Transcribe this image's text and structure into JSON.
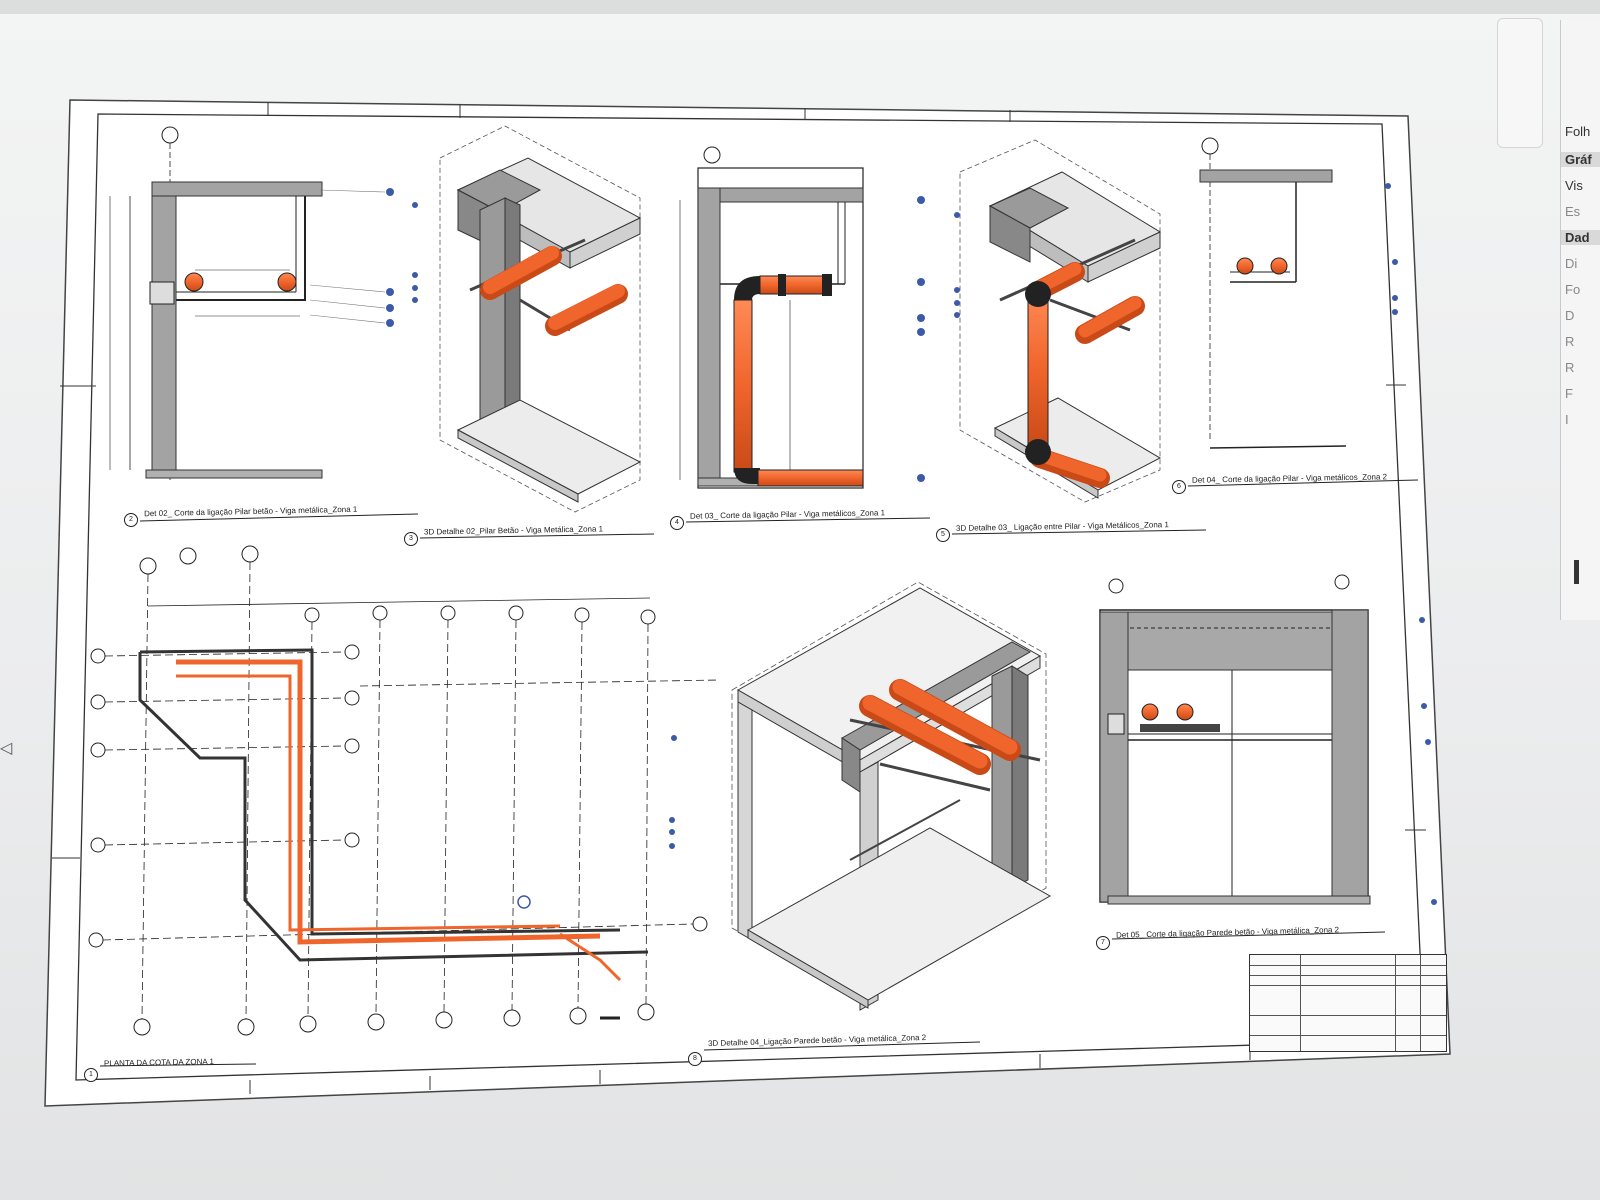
{
  "window": {
    "right_panel_items": [
      {
        "label": "Folh",
        "header": false
      },
      {
        "label": "Gráf",
        "header": true
      },
      {
        "label": "Vis",
        "header": false
      },
      {
        "label": "Es",
        "header": false
      },
      {
        "label": "Dad",
        "header": true
      },
      {
        "label": "Di",
        "header": false
      },
      {
        "label": "Fo",
        "header": false
      },
      {
        "label": "D",
        "header": false
      },
      {
        "label": "R",
        "header": false
      },
      {
        "label": "R",
        "header": false
      },
      {
        "label": "F",
        "header": false
      },
      {
        "label": "I",
        "header": false
      }
    ]
  },
  "sheet": {
    "views": [
      {
        "num": "2",
        "title": "Det 02_ Corte da ligação Pilar betão - Viga metálica_Zona 1"
      },
      {
        "num": "3",
        "title": "3D Detalhe 02_Pilar Betão - Viga Metálica_Zona 1"
      },
      {
        "num": "4",
        "title": "Det 03_ Corte da ligação Pilar - Viga metálicos_Zona 1"
      },
      {
        "num": "5",
        "title": "3D Detalhe 03_ Ligação entre Pilar - Viga Metálicos_Zona 1"
      },
      {
        "num": "6",
        "title": "Det 04_ Corte da ligação Pilar - Viga metálicos_Zona 2"
      },
      {
        "num": "1",
        "title": "PLANTA DA COTA DA ZONA 1"
      },
      {
        "num": "8",
        "title": "3D Detalhe 04_Ligação Parede betão - Viga metálica_Zona 2"
      },
      {
        "num": "7",
        "title": "Det 05_ Corte da ligação Parede betão - Viga metálica_Zona 2"
      }
    ]
  },
  "colors": {
    "pipe": "#f0652c",
    "pipe_dark": "#222222",
    "concrete": "#9c9c9c",
    "line": "#222222",
    "tag": "#3d5aa8"
  }
}
